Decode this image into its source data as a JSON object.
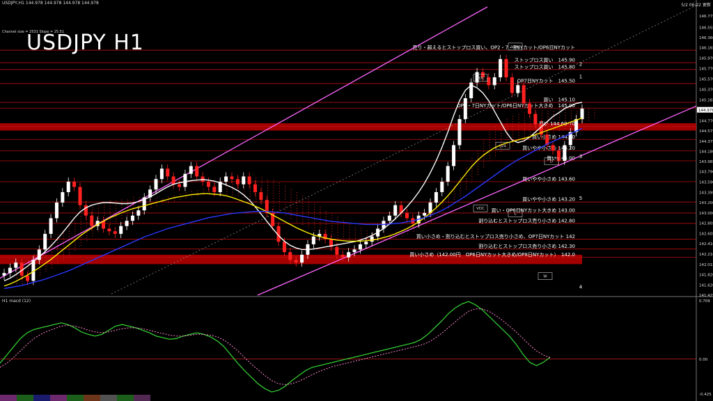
{
  "header": {
    "symbol_line": "USDJPY,H1  144.978 144.978 144.978 144.978",
    "channel_line": "Channel size = 2531 Slope = 25.51",
    "title": "USDJPY H1",
    "date_label": "5/2 06:22 更新",
    "macd_label": "H1  macd (12)"
  },
  "colors": {
    "background": "#000000",
    "bull_candle": "#ffffff",
    "bear_candle": "#ff2020",
    "channel": "#ff66ff",
    "band_red": "#c00000",
    "ma_fast": "#ffffff",
    "ma_mid": "#ffee00",
    "ma_slow": "#2a38ff",
    "macd_main": "#33cc33",
    "macd_signal": "#ff88cc",
    "cloud": "#cc2222",
    "level_line": "#cc1111"
  },
  "annotations": [
    {
      "text": "売り・超えるとストップロス買い、OP2・7・8NYカット/OP6日NYカット",
      "color": "#ffffff",
      "price": 146.12
    },
    {
      "text": "ストップロス買い　145.90",
      "color": "#ffffff",
      "price": 145.88
    },
    {
      "text": "ストップロス買い　145.80",
      "color": "#ffffff",
      "price": 145.75
    },
    {
      "text": "OP7日NYカット　145.50",
      "color": "#ffffff",
      "price": 145.48
    },
    {
      "text": "買い　145.10",
      "color": "#ffffff",
      "price": 145.12
    },
    {
      "text": "OP2・7日NYカット/OP6日NYカット大きめ　145.00",
      "color": "#ffffff",
      "price": 145.01
    },
    {
      "text": "買い 144.60-70",
      "color": "#ffffff",
      "price": 144.66
    },
    {
      "text": "買い小さめ 144.40",
      "color": "#ffffff",
      "price": 144.41
    },
    {
      "text": "買いやや小さめ 144.20",
      "color": "#ffffff",
      "price": 144.19
    },
    {
      "text": "買い 144.00",
      "color": "#ffffff",
      "price": 144.0
    },
    {
      "text": "買いやや小さめ 143.60",
      "color": "#ffffff",
      "price": 143.6
    },
    {
      "text": "買いやや小さめ 143.20",
      "color": "#ffffff",
      "price": 143.21
    },
    {
      "text": "買い・OP6日NYカット大きめ 143.00",
      "color": "#ffffff",
      "price": 143.0
    },
    {
      "text": "割り込むとストップロス売り小さめ 142.80",
      "color": "#ffffff",
      "price": 142.8
    },
    {
      "text": "買い小さめ・割り込むとストップロス売り小さめ、OP7日NYカット 142",
      "color": "#ffffff",
      "price": 142.5
    },
    {
      "text": "割り込むとストップロス売り小さめ 142.30",
      "color": "#ffffff",
      "price": 142.31
    },
    {
      "text": "買い小さめ（142.00円　OP6日NYカット大きめ/OP8日NYカット）　142.0",
      "color": "#ffffff",
      "price": 142.15
    }
  ],
  "wave_labels": [
    "1",
    "2",
    "3",
    "4",
    "5"
  ],
  "boxes": [
    "VDC",
    "VDC",
    "VDH",
    "LV4",
    "L",
    "D",
    "W"
  ],
  "chart_data": [
    {
      "type": "candlestick",
      "title": "USDJPY H1",
      "ylim": [
        141.425,
        146.975
      ],
      "y_ticks": [
        146.775,
        146.555,
        146.36,
        146.165,
        145.97,
        145.77,
        145.57,
        145.37,
        145.165,
        144.978,
        144.77,
        144.575,
        144.375,
        144.18,
        143.985,
        143.79,
        143.59,
        143.395,
        143.2,
        143.0,
        142.805,
        142.605,
        142.41,
        142.21,
        142.015,
        141.82,
        141.62,
        141.425
      ],
      "price_marker": "144.978",
      "series": [
        {
          "name": "close",
          "values": [
            141.85,
            141.95,
            142.05,
            141.8,
            141.7,
            142.1,
            142.3,
            142.6,
            142.9,
            143.2,
            143.4,
            143.6,
            143.5,
            143.15,
            142.95,
            142.75,
            142.85,
            142.7,
            142.65,
            142.6,
            142.75,
            142.85,
            142.95,
            143.05,
            143.3,
            143.45,
            143.65,
            143.85,
            143.7,
            143.55,
            143.5,
            143.75,
            143.9,
            143.7,
            143.6,
            143.5,
            143.4,
            143.6,
            143.7,
            143.65,
            143.55,
            143.7,
            143.55,
            143.4,
            143.25,
            143.0,
            142.75,
            142.45,
            142.25,
            142.1,
            142.05,
            142.2,
            142.4,
            142.55,
            142.6,
            142.5,
            142.35,
            142.2,
            142.15,
            142.25,
            142.3,
            142.4,
            142.45,
            142.55,
            142.7,
            142.85,
            142.95,
            143.15,
            143.0,
            142.9,
            142.8,
            142.95,
            143.0,
            143.2,
            143.4,
            143.6,
            143.9,
            144.3,
            144.8,
            145.2,
            145.5,
            145.7,
            145.6,
            145.45,
            145.6,
            145.95,
            145.6,
            145.3,
            145.45,
            145.1,
            144.9,
            144.7,
            144.5,
            144.3,
            144.2,
            144.0,
            144.3,
            144.55,
            144.8,
            145.0
          ]
        },
        {
          "name": "ma_fast",
          "values": [
            141.7,
            141.75,
            141.82,
            141.9,
            141.98,
            142.07,
            142.16,
            142.26,
            142.37,
            142.49,
            142.62,
            142.76,
            142.9,
            143.02,
            143.1,
            143.15,
            143.18,
            143.2,
            143.2,
            143.19,
            143.18,
            143.18,
            143.19,
            143.22,
            143.26,
            143.31,
            143.37,
            143.44,
            143.5,
            143.55,
            143.58,
            143.6,
            143.62,
            143.63,
            143.64,
            143.63,
            143.61,
            143.58,
            143.54,
            143.49,
            143.43,
            143.35,
            143.25,
            143.12,
            142.98,
            142.84,
            142.7,
            142.57,
            142.46,
            142.38,
            142.33,
            142.3,
            142.3,
            142.31,
            142.33,
            142.35,
            142.37,
            142.39,
            142.41,
            142.43,
            142.45,
            142.48,
            142.52,
            142.57,
            142.63,
            142.7,
            142.79,
            142.89,
            143.0,
            143.12,
            143.25,
            143.4,
            143.57,
            143.77,
            144.0,
            144.26,
            144.55,
            144.87,
            145.15,
            145.35,
            145.45,
            145.4,
            145.3,
            145.15,
            144.95,
            144.75,
            144.55,
            144.4,
            144.35,
            144.38,
            144.45,
            144.55,
            144.65,
            144.75,
            144.85,
            144.92,
            145.0,
            145.05,
            145.1,
            145.12
          ]
        },
        {
          "name": "ma_mid",
          "values": [
            141.6,
            141.64,
            141.69,
            141.75,
            141.81,
            141.88,
            141.95,
            142.03,
            142.11,
            142.2,
            142.29,
            142.38,
            142.47,
            142.56,
            142.64,
            142.71,
            142.78,
            142.84,
            142.9,
            142.95,
            143.0,
            143.04,
            143.08,
            143.11,
            143.14,
            143.17,
            143.2,
            143.23,
            143.26,
            143.29,
            143.31,
            143.33,
            143.35,
            143.36,
            143.37,
            143.37,
            143.36,
            143.35,
            143.33,
            143.3,
            143.26,
            143.22,
            143.18,
            143.13,
            143.08,
            143.02,
            142.96,
            142.9,
            142.84,
            142.78,
            142.72,
            142.67,
            142.62,
            142.58,
            142.55,
            142.52,
            142.5,
            142.48,
            142.47,
            142.46,
            142.46,
            142.46,
            142.47,
            142.48,
            142.5,
            142.53,
            142.56,
            142.6,
            142.65,
            142.7,
            142.76,
            142.83,
            142.91,
            143.0,
            143.1,
            143.21,
            143.33,
            143.46,
            143.6,
            143.74,
            143.88,
            144.0,
            144.1,
            144.18,
            144.25,
            144.3,
            144.34,
            144.37,
            144.4,
            144.43,
            144.46,
            144.5,
            144.54,
            144.58,
            144.62,
            144.66,
            144.7,
            144.74,
            144.78,
            144.82
          ]
        },
        {
          "name": "ma_slow",
          "values": [
            141.55,
            141.57,
            141.59,
            141.61,
            141.64,
            141.67,
            141.7,
            141.73,
            141.77,
            141.81,
            141.85,
            141.89,
            141.94,
            141.99,
            142.04,
            142.09,
            142.14,
            142.19,
            142.24,
            142.29,
            142.34,
            142.39,
            142.44,
            142.49,
            142.54,
            142.58,
            142.62,
            142.66,
            142.7,
            142.73,
            142.76,
            142.79,
            142.82,
            142.85,
            142.88,
            142.91,
            142.93,
            142.95,
            142.97,
            142.99,
            143.0,
            143.01,
            143.02,
            143.03,
            143.03,
            143.03,
            143.02,
            143.01,
            143.0,
            142.98,
            142.96,
            142.94,
            142.92,
            142.9,
            142.88,
            142.86,
            142.84,
            142.83,
            142.82,
            142.81,
            142.8,
            142.79,
            142.78,
            142.78,
            142.78,
            142.78,
            142.79,
            142.8,
            142.81,
            142.83,
            142.85,
            142.88,
            142.91,
            142.95,
            143.0,
            143.05,
            143.11,
            143.18,
            143.25,
            143.32,
            143.4,
            143.48,
            143.56,
            143.64,
            143.72,
            143.8,
            143.88,
            143.95,
            144.02,
            144.08,
            144.14,
            144.2,
            144.26,
            144.32,
            144.37,
            144.42,
            144.47,
            144.52,
            144.57,
            144.62
          ]
        }
      ]
    },
    {
      "type": "line",
      "title": "H1  macd (12)",
      "ylim": [
        -0.425,
        0.709
      ],
      "y_ticks": [
        0.709,
        0.0,
        -0.425
      ],
      "series": [
        {
          "name": "macd",
          "values": [
            -0.05,
            0.05,
            0.15,
            0.25,
            0.32,
            0.36,
            0.38,
            0.4,
            0.42,
            0.44,
            0.42,
            0.38,
            0.33,
            0.3,
            0.28,
            0.3,
            0.35,
            0.4,
            0.42,
            0.4,
            0.38,
            0.35,
            0.32,
            0.28,
            0.26,
            0.24,
            0.25,
            0.28,
            0.3,
            0.32,
            0.3,
            0.27,
            0.22,
            0.15,
            0.05,
            -0.05,
            -0.14,
            -0.22,
            -0.3,
            -0.36,
            -0.4,
            -0.38,
            -0.33,
            -0.26,
            -0.2,
            -0.14,
            -0.1,
            -0.08,
            -0.06,
            -0.04,
            -0.02,
            0.0,
            0.02,
            0.04,
            0.06,
            0.08,
            0.1,
            0.12,
            0.14,
            0.16,
            0.18,
            0.2,
            0.24,
            0.3,
            0.38,
            0.46,
            0.55,
            0.62,
            0.67,
            0.7,
            0.66,
            0.6,
            0.52,
            0.44,
            0.36,
            0.28,
            0.18,
            0.06,
            -0.04,
            -0.08,
            -0.04,
            0.02
          ]
        },
        {
          "name": "signal",
          "values": [
            -0.1,
            -0.05,
            0.02,
            0.1,
            0.18,
            0.25,
            0.3,
            0.34,
            0.37,
            0.4,
            0.41,
            0.4,
            0.38,
            0.35,
            0.33,
            0.32,
            0.33,
            0.35,
            0.37,
            0.38,
            0.38,
            0.37,
            0.35,
            0.33,
            0.31,
            0.29,
            0.28,
            0.28,
            0.29,
            0.3,
            0.3,
            0.29,
            0.27,
            0.23,
            0.17,
            0.1,
            0.02,
            -0.06,
            -0.13,
            -0.2,
            -0.26,
            -0.3,
            -0.31,
            -0.3,
            -0.27,
            -0.23,
            -0.19,
            -0.15,
            -0.12,
            -0.09,
            -0.07,
            -0.05,
            -0.03,
            -0.01,
            0.01,
            0.03,
            0.05,
            0.07,
            0.09,
            0.11,
            0.13,
            0.15,
            0.17,
            0.2,
            0.25,
            0.31,
            0.38,
            0.45,
            0.52,
            0.58,
            0.61,
            0.61,
            0.58,
            0.53,
            0.47,
            0.4,
            0.33,
            0.25,
            0.17,
            0.1,
            0.05,
            0.02
          ]
        }
      ]
    }
  ]
}
